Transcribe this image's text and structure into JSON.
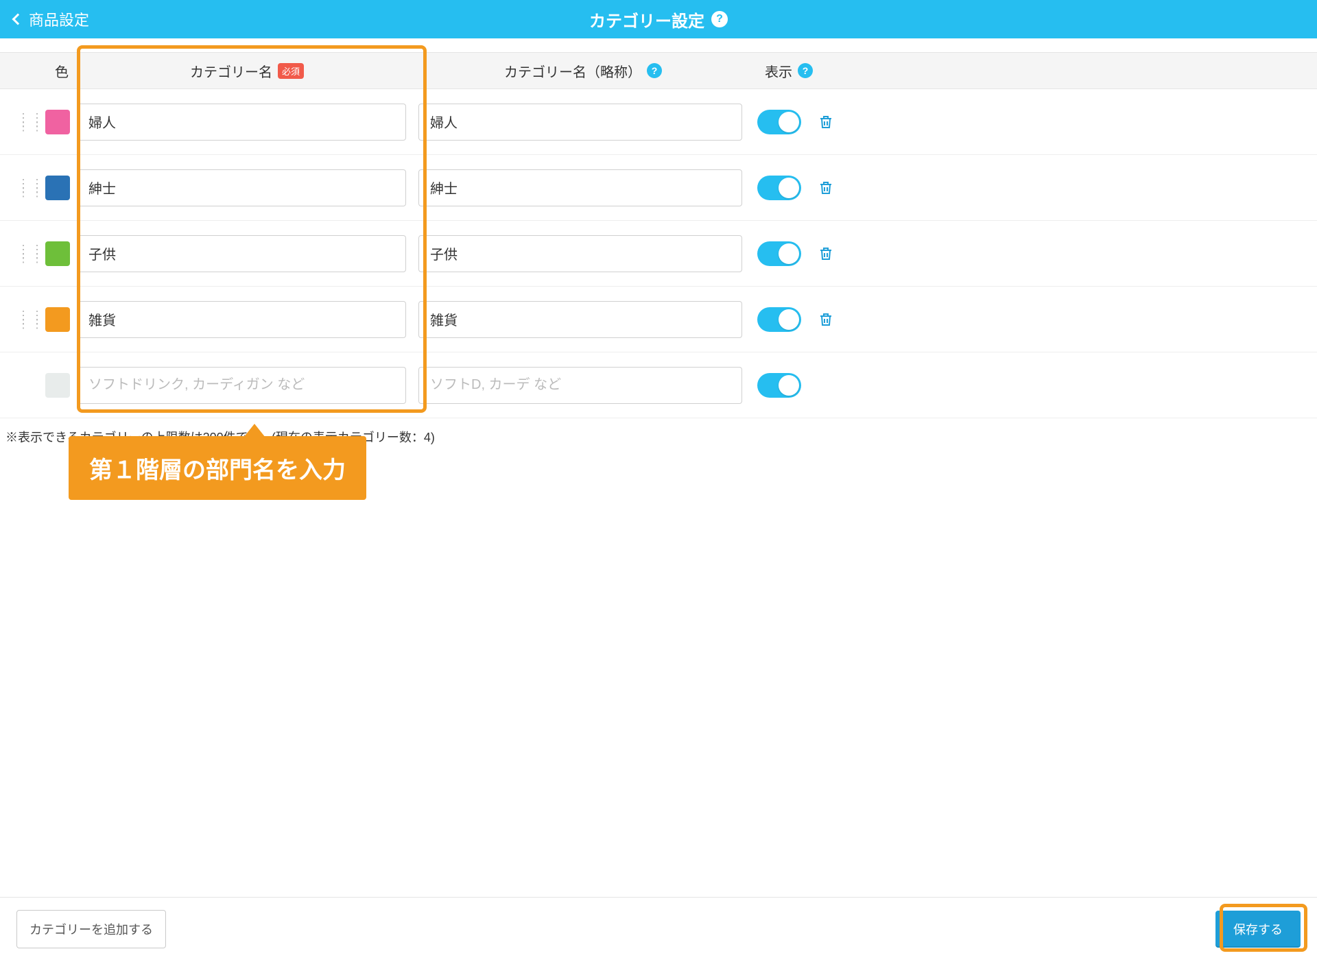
{
  "header": {
    "back_label": "商品設定",
    "title": "カテゴリー設定"
  },
  "columns": {
    "color": "色",
    "name": "カテゴリー名",
    "name_required_badge": "必須",
    "short": "カテゴリー名（略称）",
    "display": "表示"
  },
  "rows": [
    {
      "color": "#f062a1",
      "name": "婦人",
      "short": "婦人",
      "display": true,
      "has_delete": true
    },
    {
      "color": "#2a72b5",
      "name": "紳士",
      "short": "紳士",
      "display": true,
      "has_delete": true
    },
    {
      "color": "#6ebf3a",
      "name": "子供",
      "short": "子供",
      "display": true,
      "has_delete": true
    },
    {
      "color": "#f39a1f",
      "name": "雑貨",
      "short": "雑貨",
      "display": true,
      "has_delete": true
    },
    {
      "color": "#e8eceb",
      "name": "",
      "short": "",
      "display": true,
      "has_delete": false,
      "name_placeholder": "ソフトドリンク, カーディガン など",
      "short_placeholder": "ソフトD, カーデ など"
    }
  ],
  "limit_note": "※表示できるカテゴリーの上限数は200件です。(現在の表示カテゴリー数：4)",
  "footer": {
    "add_label": "カテゴリーを追加する",
    "save_label": "保存する"
  },
  "annotation": {
    "tooltip": "第１階層の部門名を入力"
  }
}
